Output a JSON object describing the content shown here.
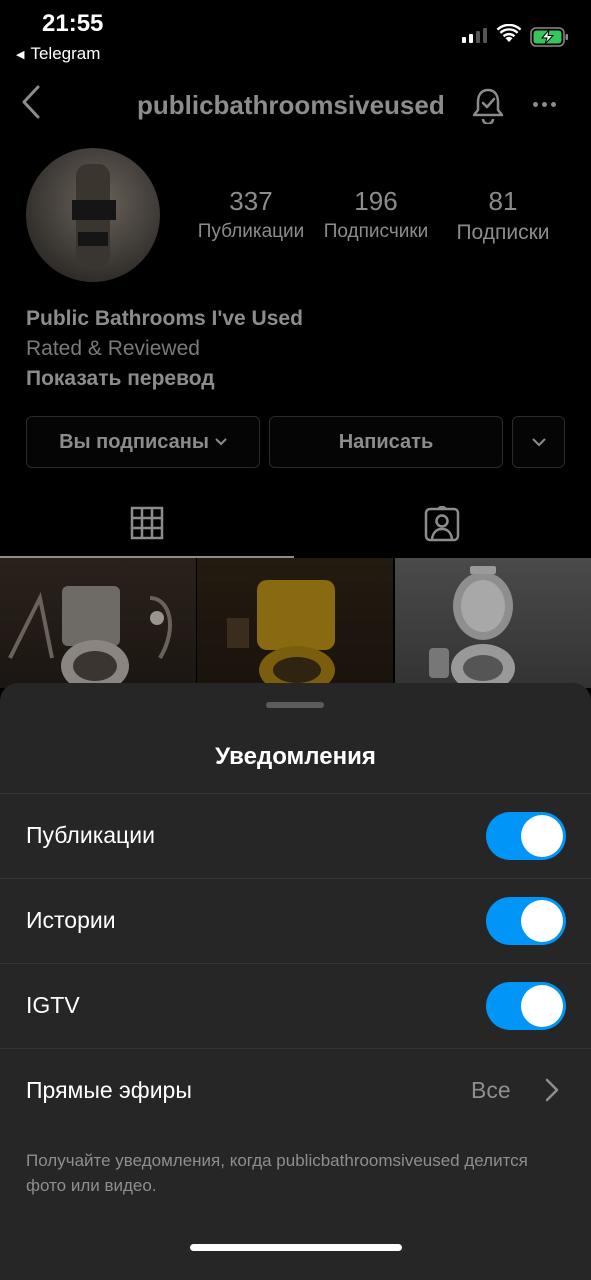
{
  "status_bar": {
    "time": "21:55",
    "back_app": "Telegram",
    "back_arrow_glyph": "◀",
    "icons": [
      "cellular-signal-icon",
      "wifi-icon",
      "battery-charging-icon"
    ],
    "battery_color": "#34c759"
  },
  "header": {
    "username": "publicbathroomsiveused",
    "icons": [
      "back-chevron-icon",
      "bell-check-icon",
      "more-horizontal-icon"
    ]
  },
  "stats": [
    {
      "value": "337",
      "label": "Публикации"
    },
    {
      "value": "196",
      "label": "Подписчики"
    },
    {
      "value": "81",
      "label": "Подписки"
    }
  ],
  "bio": {
    "name": "Public Bathrooms I've Used",
    "line": "Rated & Reviewed",
    "translate": "Показать перевод"
  },
  "actions": {
    "following_label": "Вы подписаны",
    "message_label": "Написать"
  },
  "tabs": [
    "grid-icon",
    "tagged-person-icon"
  ],
  "sheet": {
    "title": "Уведомления",
    "rows": [
      {
        "label": "Публикации",
        "on": true
      },
      {
        "label": "Истории",
        "on": true
      },
      {
        "label": "IGTV",
        "on": true
      },
      {
        "label": "Прямые эфиры",
        "value": "Все"
      }
    ],
    "helper_text": "Получайте уведомления, когда publicbathroomsiveused делится фото или видео.",
    "accent_color": "#0095f6"
  }
}
